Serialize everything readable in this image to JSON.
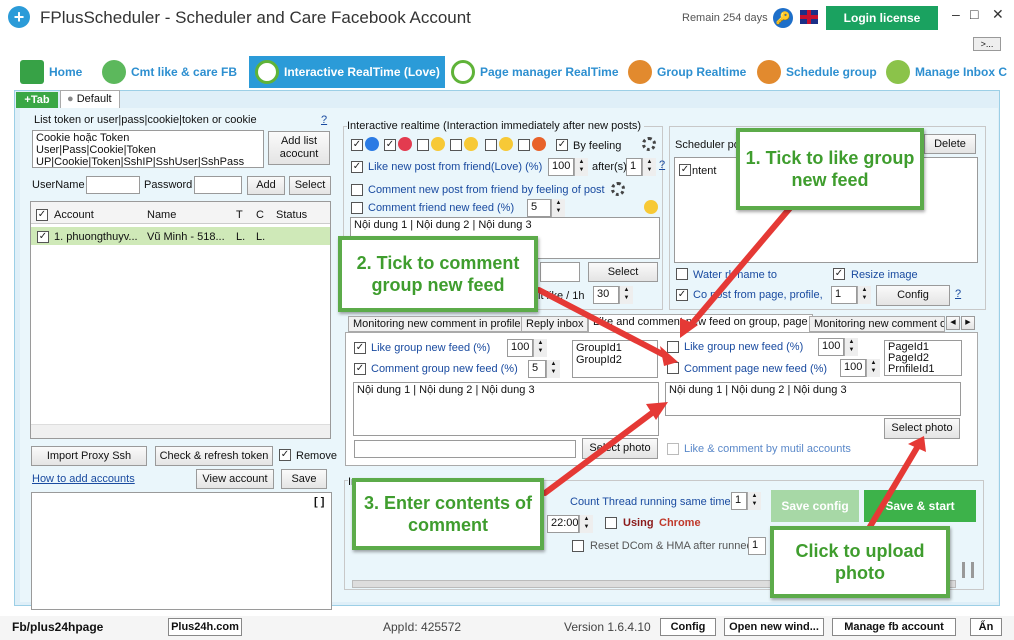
{
  "app": {
    "title": "FPlusScheduler - Scheduler and Care Facebook Account",
    "remain": "Remain 254 days",
    "login_label": "Login license",
    "more_label": ">...",
    "minimize": "–",
    "maximize": "□",
    "close": "✕"
  },
  "top_tabs": [
    {
      "label": "Home",
      "icon": "home-icon"
    },
    {
      "label": "Cmt like & care FB",
      "icon": "users-icon"
    },
    {
      "label": "Interactive RealTime (Love)",
      "icon": "clock-icon"
    },
    {
      "label": "Page manager RealTime",
      "icon": "clock-icon"
    },
    {
      "label": "Group Realtime",
      "icon": "people-icon"
    },
    {
      "label": "Schedule group",
      "icon": "people-icon"
    },
    {
      "label": "Manage Inbox C",
      "icon": "chat-icon"
    }
  ],
  "doc_tabs": {
    "add": "+Tab",
    "default": "Default"
  },
  "left": {
    "list_label": "List token or user|pass|cookie|token or cookie",
    "help": "?",
    "list_text": "Cookie hoặc Token\nUser|Pass|Cookie|Token\nUP|Cookie|Token|SshIP|SshUser|SshPass",
    "add_list_btn": "Add list acocunt",
    "username_label": "UserName",
    "password_label": "Password",
    "add_btn": "Add",
    "select_btn": "Select",
    "columns": [
      "Account",
      "Name",
      "T",
      "C",
      "Status"
    ],
    "rows": [
      {
        "account": "1. phuongthuyv...",
        "name": "Vũ Minh - 518...",
        "t": "L.",
        "c": "L.",
        "status": ""
      }
    ],
    "import_proxy_btn": "Import Proxy Ssh",
    "check_token_btn": "Check & refresh token",
    "remove_label": "Remove",
    "how_to_link": "How to add accounts",
    "view_account_btn": "View account",
    "save_btn": "Save",
    "bracket": "[ ]"
  },
  "interactive": {
    "group_title": "Interactive realtime (Interaction immediately after new posts)",
    "by_feeling": "By feeling",
    "like_post_label": "Like new post from friend(Love) (%)",
    "like_post_value": "100",
    "after_label": "after(s)",
    "after_value": "1",
    "comment_feeling_label": "Comment new post from friend by feeling of post",
    "comment_friend_label": "Comment friend new feed (%)",
    "comment_friend_value": "5",
    "content_text": "Nội dung 1 | Nội dung 2 | Nội dung 3",
    "select_btn": "Select",
    "limit_label": "it like / 1h",
    "limit_value": "30"
  },
  "scheduler": {
    "title": "Scheduler po",
    "delete_btn": "Delete",
    "content_col": "ntent",
    "watermark_label": "Water  rk name to",
    "resize_label": "Resize image",
    "copy_label": "Co   post from page, profile,",
    "copy_value": "1",
    "config_btn": "Config",
    "help": "?"
  },
  "sub_tabs": [
    "Monitoring new comment in profile",
    "Reply inbox",
    "Like and comment new feed on group, page",
    "Monitoring new comment or"
  ],
  "group_feed": {
    "like_group_label": "Like group new feed (%)",
    "like_group_value": "100",
    "comment_group_label": "Comment group new feed (%)",
    "comment_group_value": "5",
    "group_ids": "GroupId1\nGroupId2",
    "content_text": "Nội dung 1 | Nội dung 2 | Nội dung 3",
    "select_photo_btn": "Select photo"
  },
  "page_feed": {
    "like_page_label": "Like group new feed (%)",
    "like_page_value": "100",
    "comment_page_label": "Comment page new feed (%)",
    "comment_page_value": "100",
    "page_ids": "PageId1\nPageId2\nPrnfileId1",
    "content_text": "Nội dung 1 | Nội dung 2 | Nội dung 3",
    "select_photo_btn": "Select photo",
    "multi_label": "Like & comment by mutil accounts"
  },
  "bottom": {
    "in_label": "In",
    "thread_label": "Count Thread running same time",
    "thread_value": "1",
    "time_value": "22:00",
    "using_label": "Using",
    "chrome_label": "Chrome",
    "reset_label": "Reset DCom & HMA after runned",
    "reset_value": "1",
    "save_config_btn": "Save config",
    "save_start_btn": "Save & start"
  },
  "callouts": {
    "c1": "1. Tick to like group new feed",
    "c2": "2. Tick to comment group new feed",
    "c3": "3. Enter contents of comment",
    "c4": "Click to upload photo"
  },
  "status": {
    "page": "Fb/plus24hpage",
    "site_btn": "Plus24h.com",
    "app_id": "AppId: 425572",
    "version": "Version 1.6.4.10",
    "config_btn": "Config",
    "open_window_btn": "Open new wind...",
    "manage_btn": "Manage fb account",
    "hide_btn": "Ẩn"
  },
  "colors": {
    "accent": "#2b9bd8",
    "green": "#1aa260",
    "callout_border": "#5cab4a",
    "arrow": "#e53935"
  }
}
